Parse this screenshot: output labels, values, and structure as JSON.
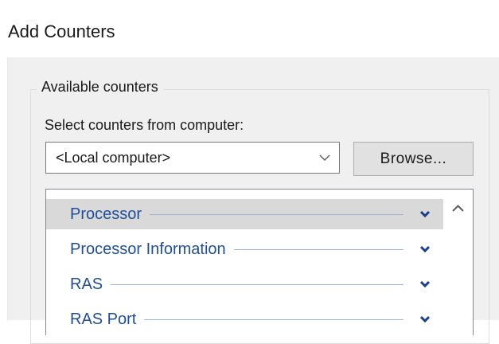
{
  "window": {
    "title": "Add Counters"
  },
  "available_group": {
    "label": "Available counters",
    "select_label": "Select counters from computer:",
    "computer_combo": {
      "value": "<Local computer>",
      "icon": "chevron-down-icon"
    },
    "browse_label": "Browse..."
  },
  "counter_list": {
    "items": [
      {
        "label": "Processor",
        "selected": true,
        "icon": "expand-chevron-icon"
      },
      {
        "label": "Processor Information",
        "selected": false,
        "icon": "expand-chevron-icon"
      },
      {
        "label": "RAS",
        "selected": false,
        "icon": "expand-chevron-icon"
      },
      {
        "label": "RAS Port",
        "selected": false,
        "icon": "expand-chevron-icon"
      }
    ],
    "scroll_up_icon": "scroll-up-arrow-icon"
  },
  "colors": {
    "link_blue": "#1f4e9a",
    "chevron_blue": "#1a3e8c",
    "selected_row": "#d9d9d9",
    "dialog_bg": "#f0f0f0"
  }
}
